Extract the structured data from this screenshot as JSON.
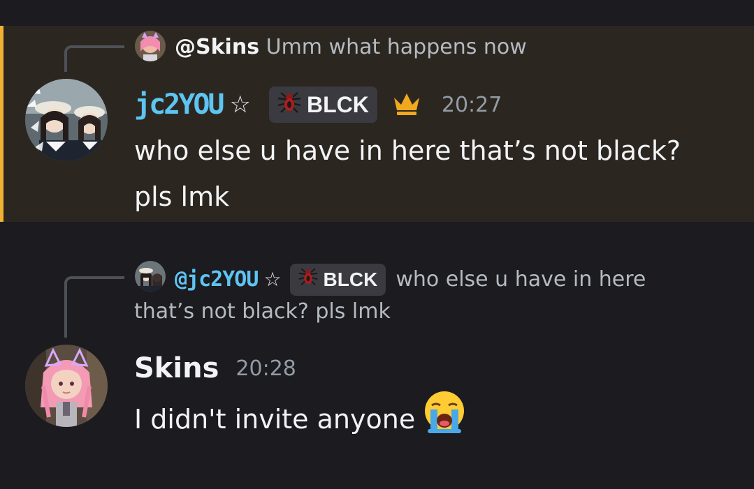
{
  "messages": [
    {
      "reply": {
        "mention": "@Skins",
        "text": "Umm what happens now"
      },
      "author": "jc2YOU",
      "author_color": "#5ec4f2",
      "tag": "BLCK",
      "timestamp": "20:27",
      "text_line1": "who else u have in here that’s not black?",
      "text_line2": "pls lmk",
      "highlighted": true,
      "highlight_color": "#f0b232"
    },
    {
      "reply": {
        "mention": "@jc2YOU",
        "tag": "BLCK",
        "text": "who else u have in here",
        "text_cont": "that’s not black? pls lmk"
      },
      "author": "Skins",
      "timestamp": "20:28",
      "text": "I didn't invite anyone",
      "emoji": "loudly-crying-face-icon"
    }
  ]
}
